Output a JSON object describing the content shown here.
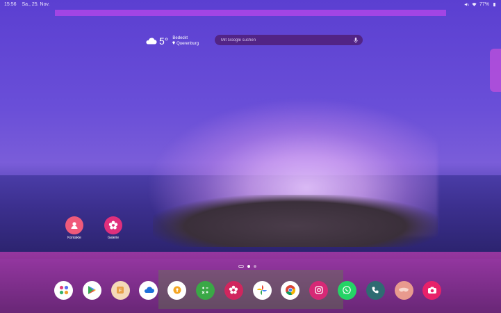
{
  "status_bar": {
    "time": "15:56",
    "date": "Sa., 25. Nov.",
    "battery": "77%"
  },
  "weather": {
    "temperature": "5°",
    "condition": "Bedeckt",
    "location": "Querenburg"
  },
  "search": {
    "placeholder": "Mit Google suchen"
  },
  "colors": {
    "accent": "#a944e6",
    "dock_band": "#b93caf"
  },
  "home_apps": [
    {
      "label": "Kontakte",
      "icon": "contacts-icon",
      "color": "#f05a7a"
    },
    {
      "label": "Galerie",
      "icon": "gallery-icon",
      "color": "#e02f7c"
    }
  ],
  "pager": {
    "pages": 2,
    "active": 0
  },
  "dock": [
    {
      "icon": "apps-folder-icon",
      "color": "#ffffff"
    },
    {
      "icon": "play-store-icon",
      "color": "#ffffff"
    },
    {
      "icon": "files-icon",
      "color": "#f5d9b8"
    },
    {
      "icon": "onedrive-icon",
      "color": "#ffffff"
    },
    {
      "icon": "keyhole-icon",
      "color": "#ffffff"
    },
    {
      "icon": "calculator-icon",
      "color": "#3aa846"
    },
    {
      "icon": "blossom-icon",
      "color": "#d0265e"
    },
    {
      "icon": "photos-pinwheel-icon",
      "color": "#ffffff"
    },
    {
      "icon": "chrome-icon",
      "color": "#ffffff"
    },
    {
      "icon": "instagram-icon",
      "color": "#d62976"
    },
    {
      "icon": "whatsapp-icon",
      "color": "#25d366"
    },
    {
      "icon": "phone-icon",
      "color": "#2f6b72"
    },
    {
      "icon": "sleep-mask-icon",
      "color": "#e89a8e"
    },
    {
      "icon": "camera-icon",
      "color": "#e8216a"
    }
  ]
}
